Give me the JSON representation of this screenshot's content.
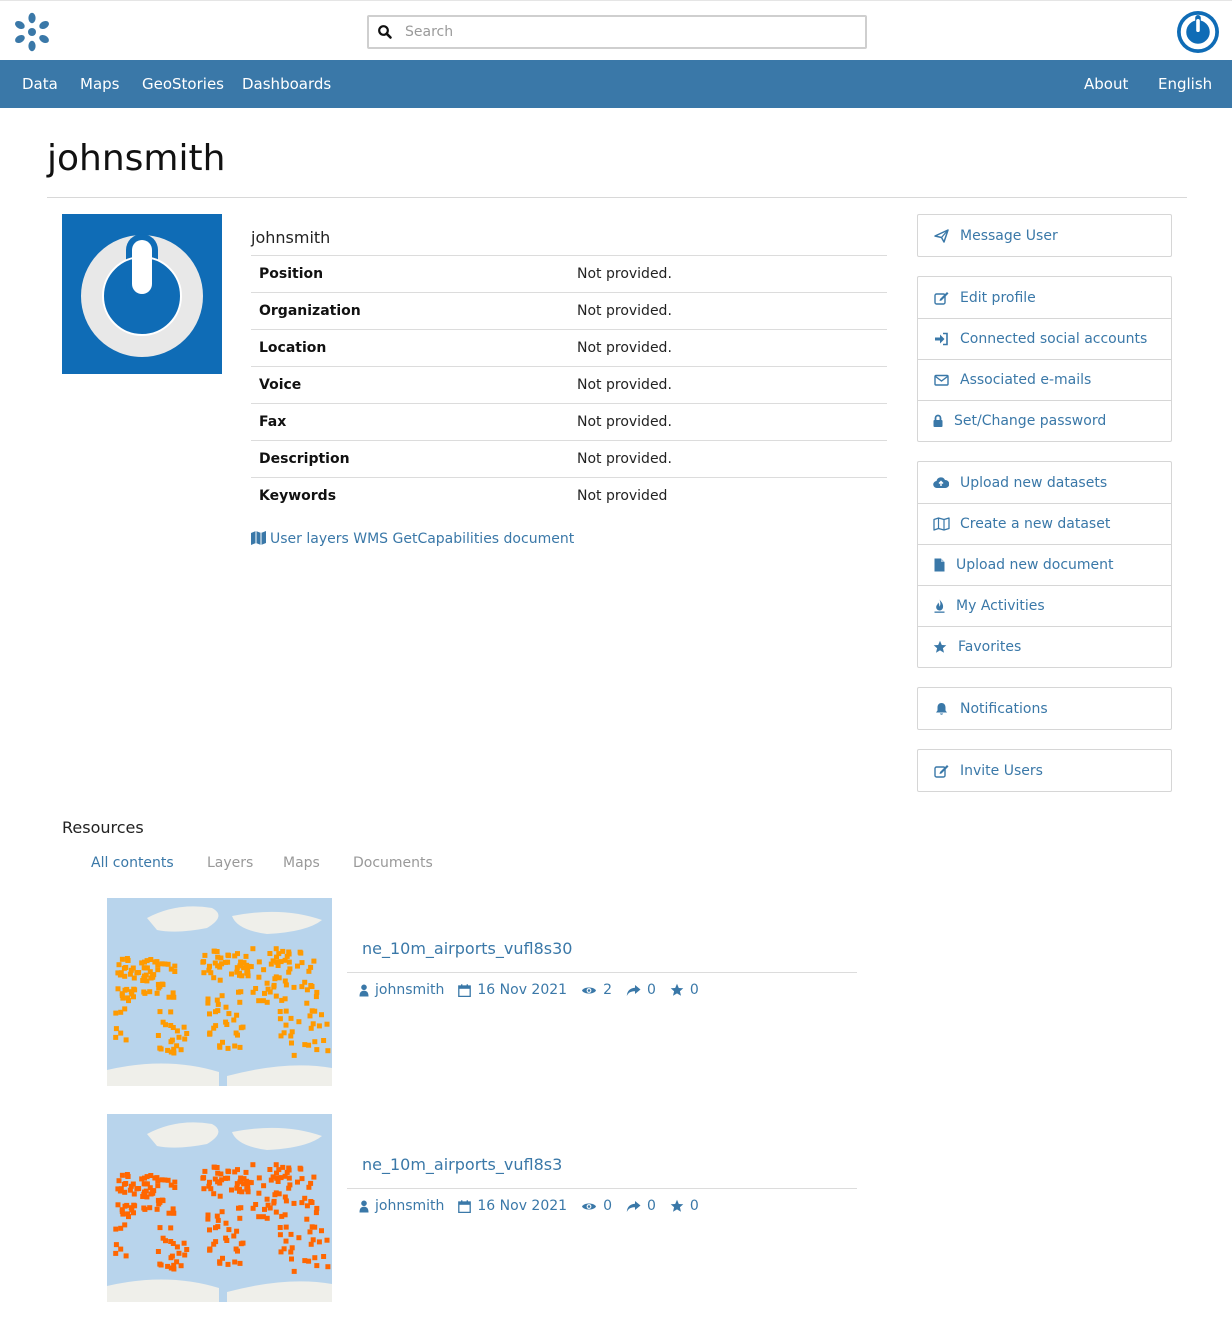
{
  "header": {
    "search_placeholder": "Search"
  },
  "nav": {
    "left": [
      "Data",
      "Maps",
      "GeoStories",
      "Dashboards"
    ],
    "right": [
      "About",
      "English"
    ]
  },
  "page": {
    "title": "johnsmith"
  },
  "profile": {
    "name": "johnsmith",
    "fields": [
      {
        "label": "Position",
        "value": "Not provided."
      },
      {
        "label": "Organization",
        "value": "Not provided."
      },
      {
        "label": "Location",
        "value": "Not provided."
      },
      {
        "label": "Voice",
        "value": "Not provided."
      },
      {
        "label": "Fax",
        "value": "Not provided."
      },
      {
        "label": "Description",
        "value": "Not provided."
      },
      {
        "label": "Keywords",
        "value": "Not provided"
      }
    ],
    "wms_link": "User layers WMS GetCapabilities document"
  },
  "actions": {
    "message": "Message User",
    "account": [
      "Edit profile",
      "Connected social accounts",
      "Associated e-mails",
      "Set/Change password"
    ],
    "content": [
      "Upload new datasets",
      "Create a new dataset",
      "Upload new document",
      "My Activities",
      "Favorites"
    ],
    "notifications": "Notifications",
    "invite": "Invite Users"
  },
  "resources": {
    "heading": "Resources",
    "tabs": [
      "All contents",
      "Layers",
      "Maps",
      "Documents"
    ],
    "items": [
      {
        "title": "ne_10m_airports_vufl8s30",
        "owner": "johnsmith",
        "date": "16 Nov 2021",
        "views": "2",
        "shares": "0",
        "favorites": "0",
        "color": "#ff9a00"
      },
      {
        "title": "ne_10m_airports_vufl8s3",
        "owner": "johnsmith",
        "date": "16 Nov 2021",
        "views": "0",
        "shares": "0",
        "favorites": "0",
        "color": "#ff6600"
      }
    ]
  },
  "colors": {
    "brand": "#3a78a8",
    "avatar_bg": "#0f6cb6"
  }
}
